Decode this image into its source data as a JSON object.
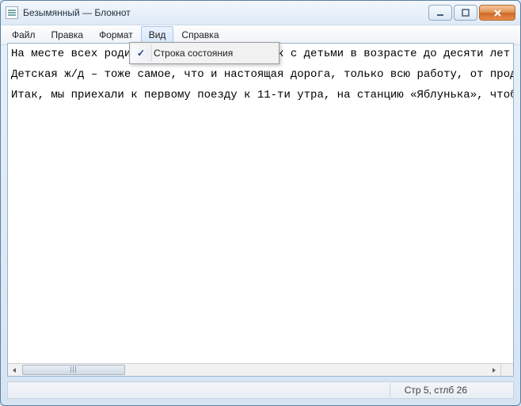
{
  "window": {
    "title": "Безымянный — Блокнот"
  },
  "menu": {
    "file": "Файл",
    "edit": "Правка",
    "format": "Формат",
    "view": "Вид",
    "help": "Справка"
  },
  "view_menu": {
    "status_bar": "Строка состояния",
    "status_bar_checked": "✓"
  },
  "content": {
    "line1": "На месте всех родителей и бабушек-дедушек с детьми в возрасте до десяти лет",
    "line2": "Детская ж/д – тоже самое, что и настоящая дорога, только всю работу, от продаж",
    "line3": "Итак, мы приехали к первому поезду к 11-ти утра, на станцию «Яблунька», чтобы"
  },
  "status": {
    "cursor": "Стр 5, стлб 26"
  }
}
